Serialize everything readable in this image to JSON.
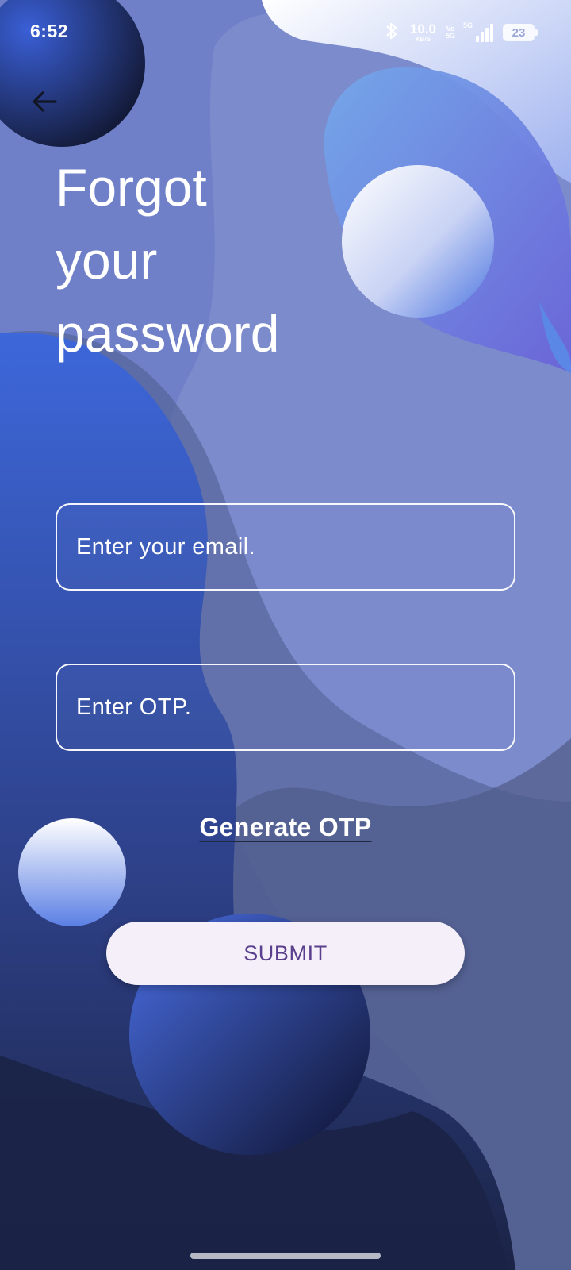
{
  "status_bar": {
    "time": "6:52",
    "net_speed_value": "10.0",
    "net_speed_unit": "KB/S",
    "volte_top": "Vo",
    "volte_bottom": "5G",
    "signal_label": "5G",
    "battery_level": "23",
    "icons": [
      "bluetooth-icon",
      "signal-icon",
      "battery-icon"
    ]
  },
  "header": {
    "back_icon": "arrow-left-icon",
    "title_lines": [
      "Forgot",
      "your",
      "password"
    ]
  },
  "form": {
    "email_placeholder": "Enter your email.",
    "email_value": "",
    "otp_placeholder": "Enter OTP.",
    "otp_value": "",
    "generate_otp_label": "Generate OTP",
    "submit_label": "SUBMIT"
  },
  "colors": {
    "background": "#6f80c8",
    "deep_blue": "#1c2548",
    "accent_blue": "#3b63d9",
    "button_bg": "#f4eff8",
    "button_text": "#5a3f8e"
  }
}
